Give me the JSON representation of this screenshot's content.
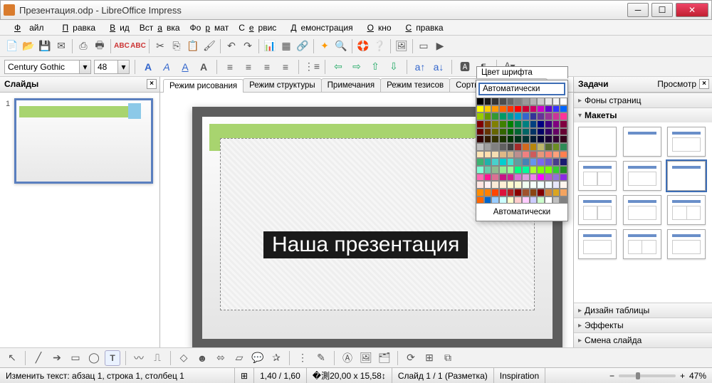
{
  "window": {
    "title": "Презентация.odp - LibreOffice Impress"
  },
  "menu": {
    "items": [
      "Файл",
      "Правка",
      "Вид",
      "Вставка",
      "Формат",
      "Сервис",
      "Демонстрация",
      "Окно",
      "Справка"
    ]
  },
  "font": {
    "name": "Century Gothic",
    "size": "48"
  },
  "viewtabs": {
    "items": [
      "Режим рисования",
      "Режим структуры",
      "Примечания",
      "Режим тезисов",
      "Сортировщик слайдов"
    ],
    "active": 0
  },
  "slidepanel": {
    "title": "Слайды",
    "num": "1"
  },
  "slide": {
    "text": "Наша презентация"
  },
  "taskpanel": {
    "title": "Задачи",
    "viewtxt": "Просмотр",
    "sections": [
      "Фоны страниц",
      "Макеты",
      "Дизайн таблицы",
      "Эффекты",
      "Смена слайда"
    ]
  },
  "colorpopup": {
    "header": "Цвет шрифта",
    "auto": "Автоматически",
    "footer": "Автоматически",
    "colors": [
      "#000000",
      "#1a1a1a",
      "#333333",
      "#4d4d4d",
      "#666666",
      "#808080",
      "#999999",
      "#b3b3b3",
      "#cccccc",
      "#e6e6e6",
      "#f2f2f2",
      "#ffffff",
      "#ffff00",
      "#ffcc00",
      "#ff9900",
      "#ff6600",
      "#ff3300",
      "#ff0000",
      "#cc0033",
      "#cc0066",
      "#cc00cc",
      "#6600cc",
      "#3333ff",
      "#0066ff",
      "#99cc00",
      "#669900",
      "#339933",
      "#009966",
      "#009999",
      "#0099cc",
      "#3366cc",
      "#333399",
      "#663399",
      "#993399",
      "#cc3399",
      "#ff3399",
      "#800000",
      "#804000",
      "#808000",
      "#408000",
      "#008000",
      "#008040",
      "#008080",
      "#004080",
      "#000080",
      "#400080",
      "#800080",
      "#800040",
      "#660000",
      "#663300",
      "#666600",
      "#336600",
      "#006600",
      "#006633",
      "#006666",
      "#003366",
      "#000066",
      "#330066",
      "#660066",
      "#660033",
      "#330000",
      "#331a00",
      "#333300",
      "#1a3300",
      "#003300",
      "#00331a",
      "#003333",
      "#001a33",
      "#000033",
      "#1a0033",
      "#330033",
      "#33001a",
      "#c0c0c0",
      "#a0a0a0",
      "#808080",
      "#606060",
      "#404040",
      "#a52a2a",
      "#d2691e",
      "#b8860b",
      "#bdb76b",
      "#556b2f",
      "#6b8e23",
      "#2e8b57",
      "#ffe4b5",
      "#ffdead",
      "#f5deb3",
      "#deb887",
      "#d2b48c",
      "#bc8f8f",
      "#f08080",
      "#cd5c5c",
      "#e9967a",
      "#fa8072",
      "#ffa07a",
      "#ff7f50",
      "#3cb371",
      "#20b2aa",
      "#48d1cc",
      "#00ced1",
      "#40e0d0",
      "#5f9ea0",
      "#4682b4",
      "#6495ed",
      "#7b68ee",
      "#6a5acd",
      "#483d8b",
      "#191970",
      "#7fffd4",
      "#66cdaa",
      "#8fbc8f",
      "#90ee90",
      "#98fb98",
      "#00ff7f",
      "#00fa9a",
      "#adff2f",
      "#7fff00",
      "#7cfc00",
      "#32cd32",
      "#228b22",
      "#ff69b4",
      "#ff1493",
      "#db7093",
      "#c71585",
      "#d02090",
      "#da70d6",
      "#dda0dd",
      "#ee82ee",
      "#ff00ff",
      "#ba55d3",
      "#9370db",
      "#8a2be2",
      "#ffe4e1",
      "#fff0f5",
      "#faebd7",
      "#ffefd5",
      "#fffacd",
      "#fafad2",
      "#f0fff0",
      "#f5fffa",
      "#f0ffff",
      "#f0f8ff",
      "#e6e6fa",
      "#fff5ee",
      "#ff8c00",
      "#ff7f00",
      "#ff4500",
      "#dc143c",
      "#b22222",
      "#8b0000",
      "#a0522d",
      "#8b4513",
      "#800000",
      "#cd853f",
      "#daa520",
      "#f4a460",
      "#ff6600",
      "#0066cc",
      "#99ccff",
      "#ccffff",
      "#ffffcc",
      "#ffcccc",
      "#ffccff",
      "#ccccff",
      "#ccffcc",
      "#ffffff",
      "#c0c0c0",
      "#808080"
    ]
  },
  "status": {
    "edit": "Изменить текст: абзац 1, строка 1, столбец 1",
    "pos": "1,40 / 1,60",
    "size": "20,00 x 15,58",
    "slide": "Слайд 1 / 1 (Разметка)",
    "master": "Inspiration",
    "zoom": "47%"
  }
}
